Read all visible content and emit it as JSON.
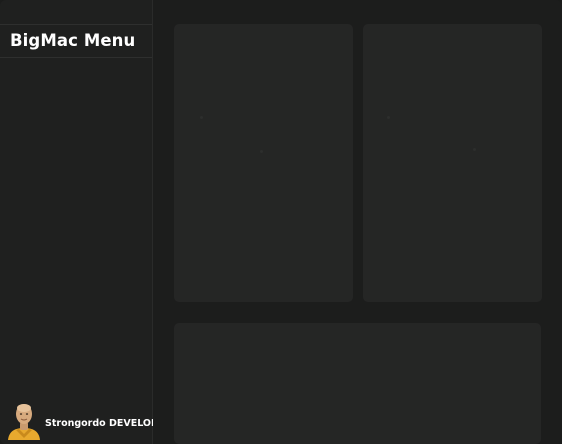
{
  "sidebar": {
    "title": "BigMac Menu"
  },
  "user": {
    "name": "Strongordo DEVELOPER",
    "avatar_icon": "user-avatar-icon"
  },
  "colors": {
    "background": "#1c1d1c",
    "sidebar": "#1f201f",
    "panel": "#252625",
    "text": "#ffffff",
    "avatar_accent": "#f2b63a"
  }
}
